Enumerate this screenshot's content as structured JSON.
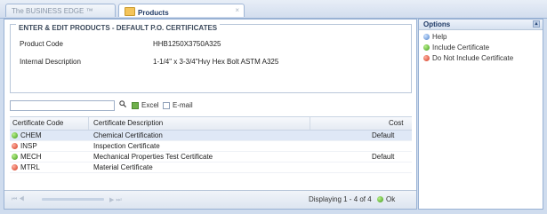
{
  "tabs": [
    {
      "label": "The BUSINESS EDGE ™"
    },
    {
      "label": "Products",
      "close": "×"
    }
  ],
  "form": {
    "legend": "ENTER & EDIT PRODUCTS - DEFAULT P.O. CERTIFICATES",
    "product_code_label": "Product Code",
    "product_code_value": "HHB1250X3750A325",
    "internal_desc_label": "Internal Description",
    "internal_desc_value": "1-1/4\" x 3-3/4\"Hvy Hex Bolt ASTM A325"
  },
  "toolbar": {
    "search_value": "",
    "excel_label": "Excel",
    "email_label": "E-mail"
  },
  "grid": {
    "columns": [
      "Certificate Code",
      "Certificate Description",
      "Cost"
    ],
    "rows": [
      {
        "code": "CHEM",
        "description": "Chemical Certification",
        "cost": "Default",
        "status": "green"
      },
      {
        "code": "INSP",
        "description": "Inspection Certificate",
        "cost": "",
        "status": "red"
      },
      {
        "code": "MECH",
        "description": "Mechanical Properties Test Certificate",
        "cost": "Default",
        "status": "green"
      },
      {
        "code": "MTRL",
        "description": "Material Certificate",
        "cost": "",
        "status": "red"
      }
    ]
  },
  "footer": {
    "pager": "⏮ ◀",
    "pager_next": "▶ ⏭",
    "status": "Displaying 1 - 4 of 4",
    "ok_label": "Ok"
  },
  "options": {
    "title": "Options",
    "collapse": "▴",
    "items": [
      {
        "label": "Help",
        "icon": "help-icon"
      },
      {
        "label": "Include Certificate",
        "icon": "include-icon"
      },
      {
        "label": "Do Not Include Certificate",
        "icon": "exclude-icon"
      }
    ]
  }
}
